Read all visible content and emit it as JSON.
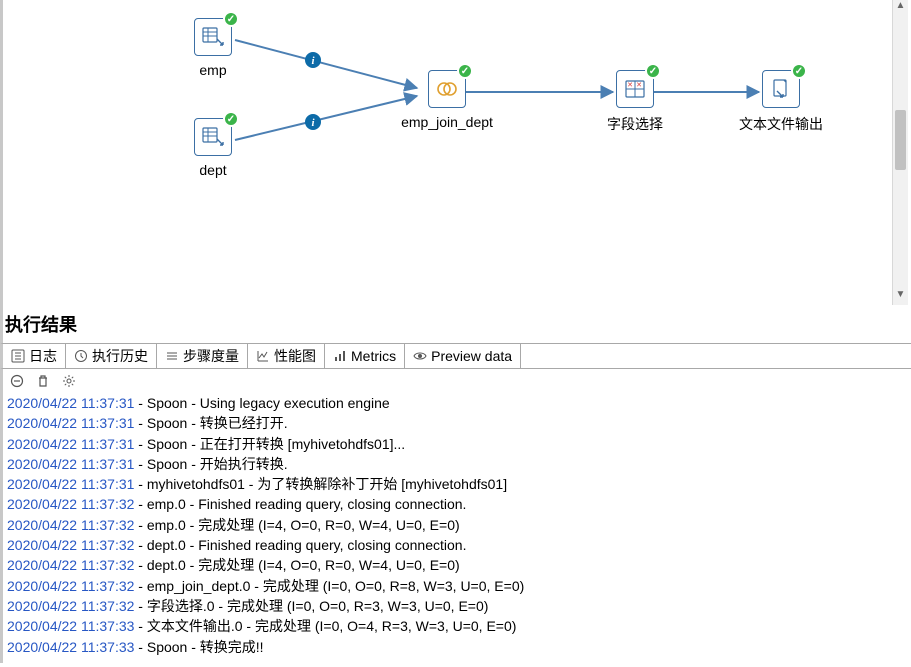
{
  "canvas": {
    "nodes": {
      "emp": {
        "label": "emp"
      },
      "dept": {
        "label": "dept"
      },
      "join": {
        "label": "emp_join_dept"
      },
      "select": {
        "label": "字段选择"
      },
      "output": {
        "label": "文本文件输出"
      }
    }
  },
  "section_title": "执行结果",
  "tabs": {
    "log": "日志",
    "history": "执行历史",
    "metrics_step": "步骤度量",
    "perf": "性能图",
    "metrics": "Metrics",
    "preview": "Preview data"
  },
  "log": [
    {
      "ts": "2020/04/22 11:37:31",
      "msg": "Spoon - Using legacy execution engine"
    },
    {
      "ts": "2020/04/22 11:37:31",
      "msg": "Spoon - 转换已经打开."
    },
    {
      "ts": "2020/04/22 11:37:31",
      "msg": "Spoon - 正在打开转换 [myhivetohdfs01]..."
    },
    {
      "ts": "2020/04/22 11:37:31",
      "msg": "Spoon - 开始执行转换."
    },
    {
      "ts": "2020/04/22 11:37:31",
      "msg": "myhivetohdfs01 - 为了转换解除补丁开始  [myhivetohdfs01]"
    },
    {
      "ts": "2020/04/22 11:37:32",
      "msg": "emp.0 - Finished reading query, closing connection."
    },
    {
      "ts": "2020/04/22 11:37:32",
      "msg": "emp.0 - 完成处理 (I=4, O=0, R=0, W=4, U=0, E=0)"
    },
    {
      "ts": "2020/04/22 11:37:32",
      "msg": "dept.0 - Finished reading query, closing connection."
    },
    {
      "ts": "2020/04/22 11:37:32",
      "msg": "dept.0 - 完成处理 (I=4, O=0, R=0, W=4, U=0, E=0)"
    },
    {
      "ts": "2020/04/22 11:37:32",
      "msg": "emp_join_dept.0 - 完成处理 (I=0, O=0, R=8, W=3, U=0, E=0)"
    },
    {
      "ts": "2020/04/22 11:37:32",
      "msg": "字段选择.0 - 完成处理 (I=0, O=0, R=3, W=3, U=0, E=0)"
    },
    {
      "ts": "2020/04/22 11:37:33",
      "msg": "文本文件输出.0 - 完成处理 (I=0, O=4, R=3, W=3, U=0, E=0)"
    },
    {
      "ts": "2020/04/22 11:37:33",
      "msg": "Spoon - 转换完成!!"
    }
  ]
}
